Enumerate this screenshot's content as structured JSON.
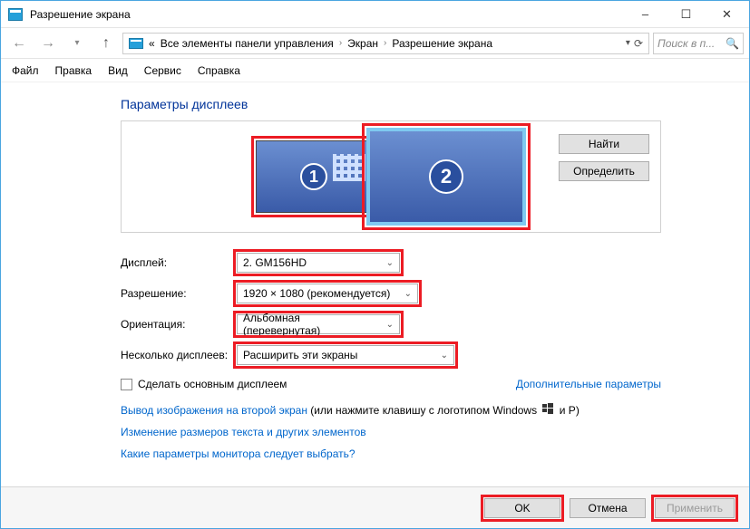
{
  "window": {
    "title": "Разрешение экрана",
    "minimize": "–",
    "maximize": "☐",
    "close": "✕"
  },
  "breadcrumb": {
    "items": [
      "Все элементы панели управления",
      "Экран",
      "Разрешение экрана"
    ]
  },
  "search": {
    "placeholder": "Поиск в п..."
  },
  "menu": {
    "file": "Файл",
    "edit": "Правка",
    "view": "Вид",
    "service": "Сервис",
    "help": "Справка"
  },
  "page": {
    "heading": "Параметры дисплеев"
  },
  "monitors": {
    "m1": "1",
    "m2": "2"
  },
  "side_buttons": {
    "find": "Найти",
    "identify": "Определить"
  },
  "form": {
    "display_label": "Дисплей:",
    "display_value": "2. GM156HD",
    "resolution_label": "Разрешение:",
    "resolution_value": "1920 × 1080 (рекомендуется)",
    "orientation_label": "Ориентация:",
    "orientation_value": "Альбомная (перевернутая)",
    "multi_label": "Несколько дисплеев:",
    "multi_value": "Расширить эти экраны"
  },
  "checkbox": {
    "label": "Сделать основным дисплеем"
  },
  "links": {
    "advanced": "Дополнительные параметры",
    "project_link": "Вывод изображения на второй экран",
    "project_rest": " (или нажмите клавишу с логотипом Windows ",
    "project_tail": " и P)",
    "text_scaling": "Изменение размеров текста и других элементов",
    "which_monitor": "Какие параметры монитора следует выбрать?"
  },
  "footer": {
    "ok": "OK",
    "cancel": "Отмена",
    "apply": "Применить"
  }
}
